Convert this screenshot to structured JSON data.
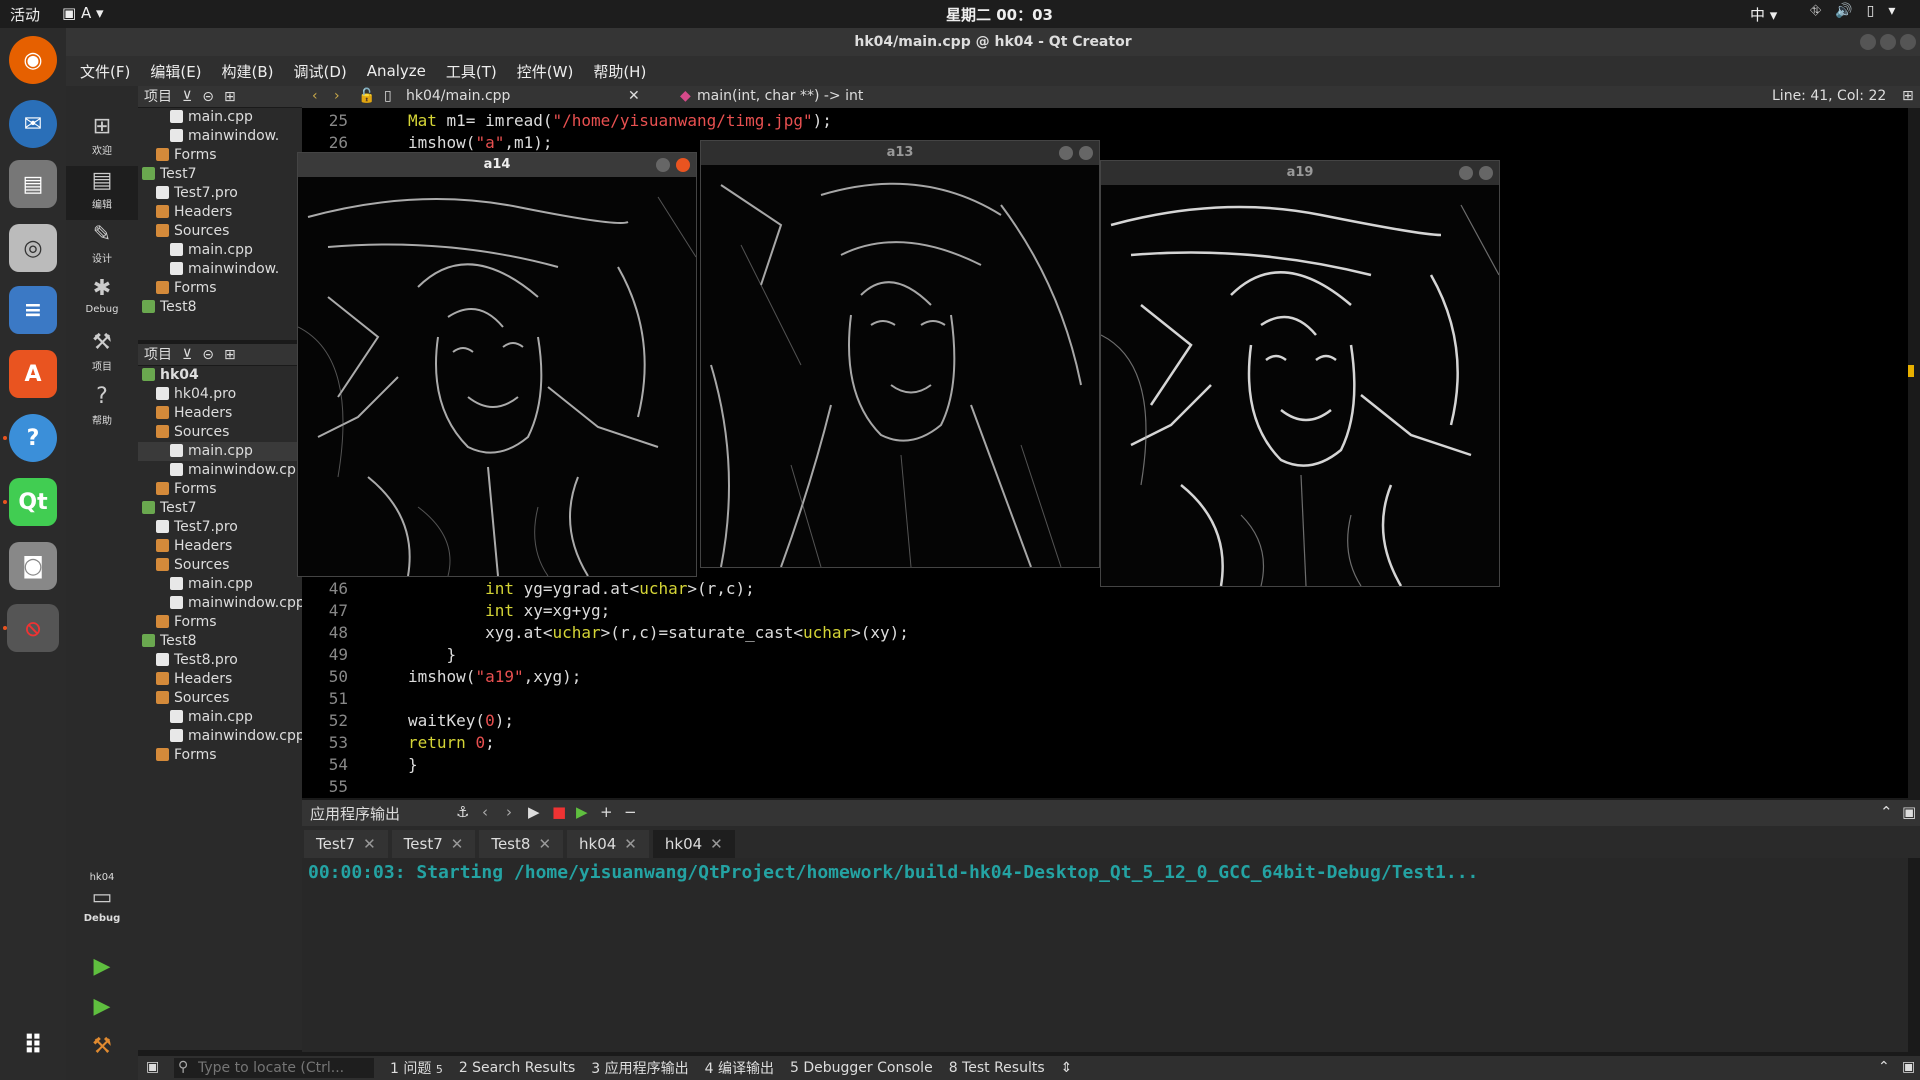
{
  "topbar": {
    "activities": "活动",
    "keyboard": "A",
    "clock": "星期二 00：03",
    "ime": "中"
  },
  "window": {
    "title": "hk04/main.cpp @ hk04 - Qt Creator"
  },
  "menu": [
    "文件(F)",
    "编辑(E)",
    "构建(B)",
    "调试(D)",
    "Analyze",
    "工具(T)",
    "控件(W)",
    "帮助(H)"
  ],
  "modes": [
    {
      "label": "欢迎",
      "icon": "grid-icon"
    },
    {
      "label": "编辑",
      "icon": "edit-icon"
    },
    {
      "label": "设计",
      "icon": "pencil-icon"
    },
    {
      "label": "Debug",
      "icon": "bug-icon"
    },
    {
      "label": "项目",
      "icon": "wrench-icon"
    },
    {
      "label": "帮助",
      "icon": "help-icon"
    }
  ],
  "kit": {
    "name": "hk04",
    "mode": "Debug"
  },
  "projects_panel_title": "项目",
  "tree_top": [
    {
      "label": "main.cpp",
      "kind": "file",
      "indent": 2
    },
    {
      "label": "mainwindow.",
      "kind": "file",
      "indent": 2
    },
    {
      "label": "Forms",
      "kind": "folder",
      "indent": 1
    },
    {
      "label": "Test7",
      "kind": "proj",
      "indent": 0
    },
    {
      "label": "Test7.pro",
      "kind": "file",
      "indent": 1
    },
    {
      "label": "Headers",
      "kind": "folder",
      "indent": 1
    },
    {
      "label": "Sources",
      "kind": "folder",
      "indent": 1
    },
    {
      "label": "main.cpp",
      "kind": "file",
      "indent": 2
    },
    {
      "label": "mainwindow.",
      "kind": "file",
      "indent": 2
    },
    {
      "label": "Forms",
      "kind": "folder",
      "indent": 1
    },
    {
      "label": "Test8",
      "kind": "proj",
      "indent": 0
    }
  ],
  "tree_bottom": [
    {
      "label": "hk04",
      "kind": "proj",
      "indent": 0
    },
    {
      "label": "hk04.pro",
      "kind": "file",
      "indent": 1
    },
    {
      "label": "Headers",
      "kind": "folder",
      "indent": 1
    },
    {
      "label": "Sources",
      "kind": "folder",
      "indent": 1
    },
    {
      "label": "main.cpp",
      "kind": "file",
      "indent": 2
    },
    {
      "label": "mainwindow.cpp",
      "kind": "file",
      "indent": 2
    },
    {
      "label": "Forms",
      "kind": "folder",
      "indent": 1
    },
    {
      "label": "Test7",
      "kind": "proj",
      "indent": 0
    },
    {
      "label": "Test7.pro",
      "kind": "file",
      "indent": 1
    },
    {
      "label": "Headers",
      "kind": "folder",
      "indent": 1
    },
    {
      "label": "Sources",
      "kind": "folder",
      "indent": 1
    },
    {
      "label": "main.cpp",
      "kind": "file",
      "indent": 2
    },
    {
      "label": "mainwindow.cpp",
      "kind": "file",
      "indent": 2
    },
    {
      "label": "Forms",
      "kind": "folder",
      "indent": 1
    },
    {
      "label": "Test8",
      "kind": "proj",
      "indent": 0
    },
    {
      "label": "Test8.pro",
      "kind": "file",
      "indent": 1
    },
    {
      "label": "Headers",
      "kind": "folder",
      "indent": 1
    },
    {
      "label": "Sources",
      "kind": "folder",
      "indent": 1
    },
    {
      "label": "main.cpp",
      "kind": "file",
      "indent": 2
    },
    {
      "label": "mainwindow.cpp",
      "kind": "file",
      "indent": 2
    },
    {
      "label": "Forms",
      "kind": "folder",
      "indent": 1
    }
  ],
  "editor": {
    "file": "hk04/main.cpp",
    "symbol": "main(int, char **) -> int",
    "position": "Line: 41, Col: 22"
  },
  "code_top": [
    {
      "n": "25",
      "html": "<span class=\"kw\">Mat</span> m1= imread(<span class=\"str\">\"/home/yisuanwang/timg.jpg\"</span>);"
    },
    {
      "n": "26",
      "html": "imshow(<span class=\"str\">\"a\"</span>,m1);"
    }
  ],
  "code_bottom": [
    {
      "n": "46",
      "html": "        <span class=\"kw\">int</span> yg=ygrad.at&lt;<span class=\"kw\">uchar</span>&gt;(r,c);"
    },
    {
      "n": "47",
      "html": "        <span class=\"kw\">int</span> xy=xg+yg;"
    },
    {
      "n": "48",
      "html": "        xyg.at&lt;<span class=\"kw\">uchar</span>&gt;(r,c)=saturate_cast&lt;<span class=\"kw\">uchar</span>&gt;(xy);"
    },
    {
      "n": "49",
      "html": "    }"
    },
    {
      "n": "50",
      "html": "imshow(<span class=\"str\">\"a19\"</span>,xyg);"
    },
    {
      "n": "51",
      "html": ""
    },
    {
      "n": "52",
      "html": "waitKey(<span class=\"num\">0</span>);"
    },
    {
      "n": "53",
      "html": "<span class=\"kw\">return</span> <span class=\"num\">0</span>;"
    },
    {
      "n": "54",
      "html": "}"
    },
    {
      "n": "55",
      "html": ""
    }
  ],
  "image_windows": [
    {
      "title": "a14"
    },
    {
      "title": "a13"
    },
    {
      "title": "a19"
    }
  ],
  "output": {
    "title": "应用程序输出",
    "tabs": [
      "Test7",
      "Test7",
      "Test8",
      "hk04",
      "hk04"
    ],
    "text": "00:00:03: Starting /home/yisuanwang/QtProject/homework/build-hk04-Desktop_Qt_5_12_0_GCC_64bit-Debug/Test1..."
  },
  "statusbar": {
    "locate_placeholder": "Type to locate (Ctrl...",
    "tabs": [
      "1 问题",
      "2 Search Results",
      "3 应用程序输出",
      "4 编译输出",
      "5 Debugger Console",
      "8 Test Results"
    ],
    "issues_count": "5"
  },
  "colors": {
    "accent": "#e95420",
    "output_text": "#24a3a3"
  }
}
